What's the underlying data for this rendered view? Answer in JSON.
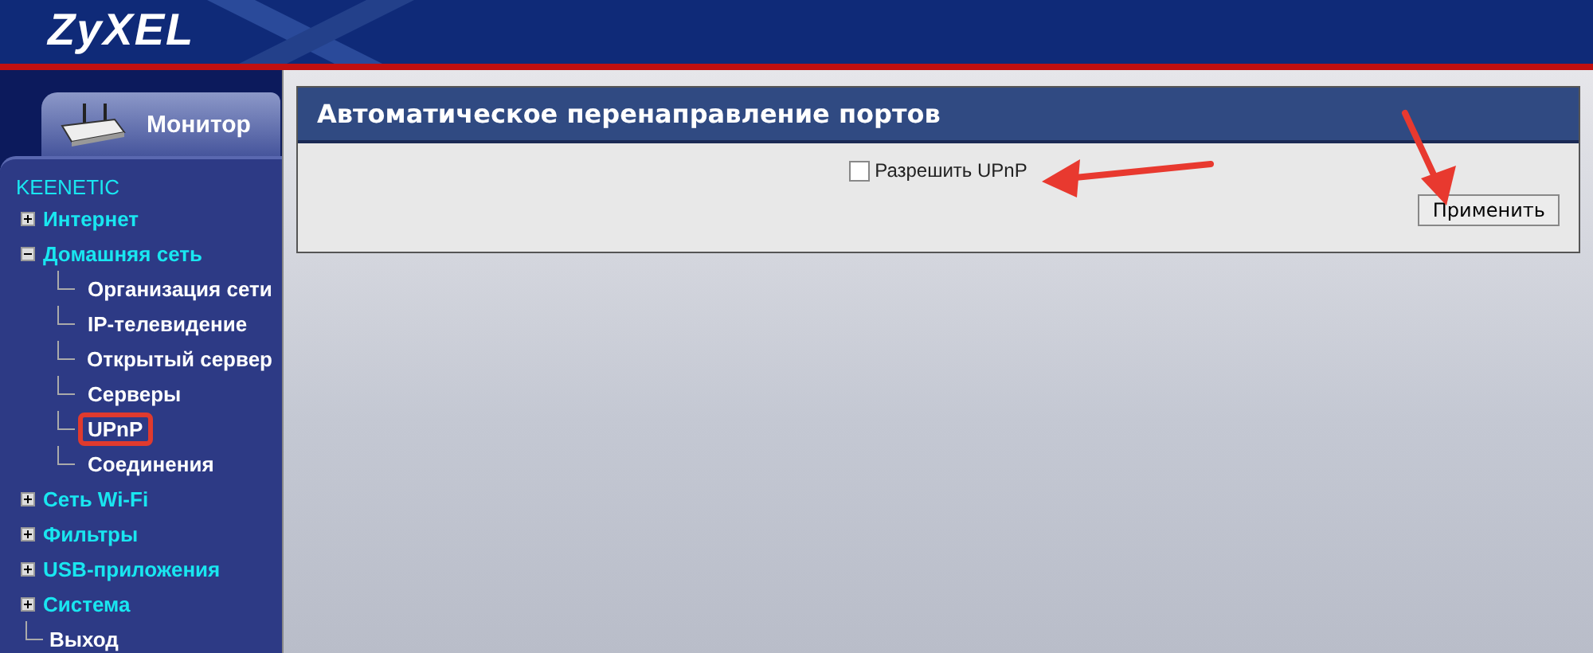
{
  "header": {
    "logo": "ZyXEL"
  },
  "sidebar": {
    "tab": {
      "label": "Монитор",
      "selected": true
    },
    "device": "KEENETIC",
    "items": [
      {
        "label": "Интернет",
        "expanded": false,
        "selected": false
      },
      {
        "label": "Домашняя сеть",
        "expanded": true,
        "selected": false,
        "children": [
          {
            "label": "Организация сети",
            "selected": false
          },
          {
            "label": "IP-телевидение",
            "selected": false
          },
          {
            "label": "Открытый сервер",
            "selected": false
          },
          {
            "label": "Серверы",
            "selected": false
          },
          {
            "label": "UPnP",
            "selected": true
          },
          {
            "label": "Соединения",
            "selected": false
          }
        ]
      },
      {
        "label": "Сеть Wi-Fi",
        "expanded": false,
        "selected": false
      },
      {
        "label": "Фильтры",
        "expanded": false,
        "selected": false
      },
      {
        "label": "USB-приложения",
        "expanded": false,
        "selected": false
      },
      {
        "label": "Система",
        "expanded": false,
        "selected": false
      },
      {
        "label": "Выход",
        "kind": "link",
        "selected": false
      }
    ]
  },
  "panel": {
    "title": "Автоматическое перенаправление портов",
    "checkbox": {
      "label": "Разрешить UPnP",
      "checked": false
    },
    "button": "Применить"
  }
}
